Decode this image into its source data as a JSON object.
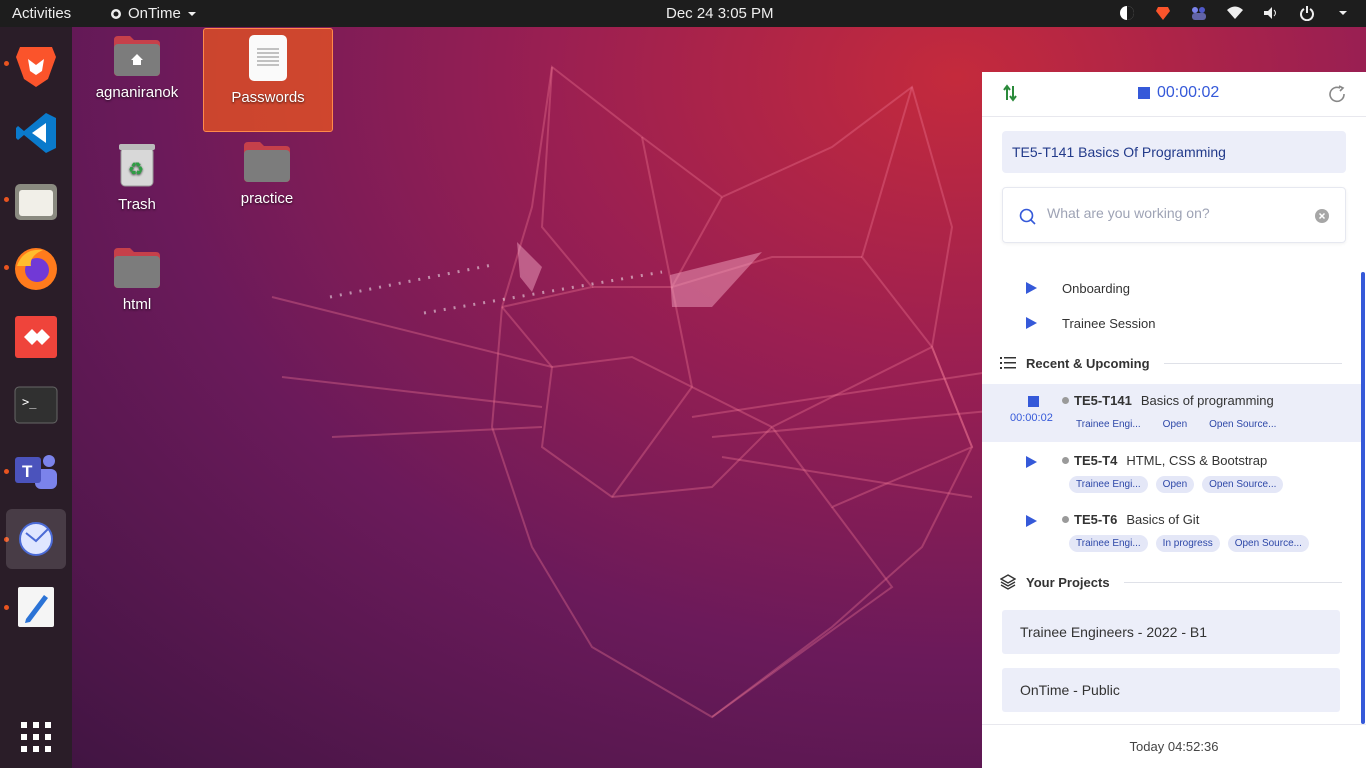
{
  "topbar": {
    "activities": "Activities",
    "app_name": "OnTime",
    "clock": "Dec 24  3:05 PM"
  },
  "dock": {
    "items": [
      "brave-browser",
      "vs-code",
      "files",
      "firefox",
      "anydesk",
      "terminal",
      "teams",
      "ontime",
      "text-editor"
    ],
    "show_apps": "show-applications"
  },
  "desktop": {
    "icons": [
      {
        "label": "agnaniranok",
        "type": "home-folder"
      },
      {
        "label": "Passwords",
        "type": "text-file"
      },
      {
        "label": "Trash",
        "type": "trash"
      },
      {
        "label": "practice",
        "type": "folder"
      },
      {
        "label": "html",
        "type": "folder"
      }
    ]
  },
  "panel": {
    "timer": "00:00:02",
    "current_task": "TE5-T141 Basics Of Programming",
    "search_placeholder": "What are you working on?",
    "quick_items": [
      "Onboarding",
      "Trainee Session"
    ],
    "recent_heading": "Recent & Upcoming",
    "tasks": [
      {
        "code": "TE5-T141",
        "title": "Basics of programming",
        "elapsed": "00:00:02",
        "tags": [
          "Trainee Engi...",
          "Open",
          "Open Source..."
        ],
        "running": true
      },
      {
        "code": "TE5-T4",
        "title": "HTML, CSS & Bootstrap",
        "tags": [
          "Trainee Engi...",
          "Open",
          "Open Source..."
        ],
        "running": false
      },
      {
        "code": "TE5-T6",
        "title": "Basics of Git",
        "tags": [
          "Trainee Engi...",
          "In progress",
          "Open Source..."
        ],
        "running": false
      }
    ],
    "projects_heading": "Your Projects",
    "projects": [
      "Trainee Engineers - 2022 - B1",
      "OnTime - Public"
    ],
    "footer": "Today  04:52:36"
  },
  "colors": {
    "accent": "#3559d9",
    "selection": "#e95420",
    "topbar": "#1d1d1d"
  }
}
